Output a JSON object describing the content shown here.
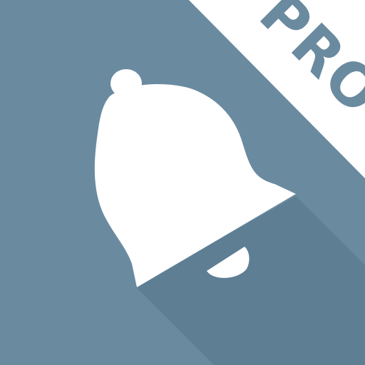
{
  "app_icon": {
    "badge_text": "PRO",
    "icon_name": "bell-icon",
    "colors": {
      "background": "#6a8aa0",
      "shadow": "#5b7a8f",
      "bell": "#ffffff",
      "ribbon": "#ffffff",
      "ribbon_text": "#6a8aa0"
    }
  }
}
